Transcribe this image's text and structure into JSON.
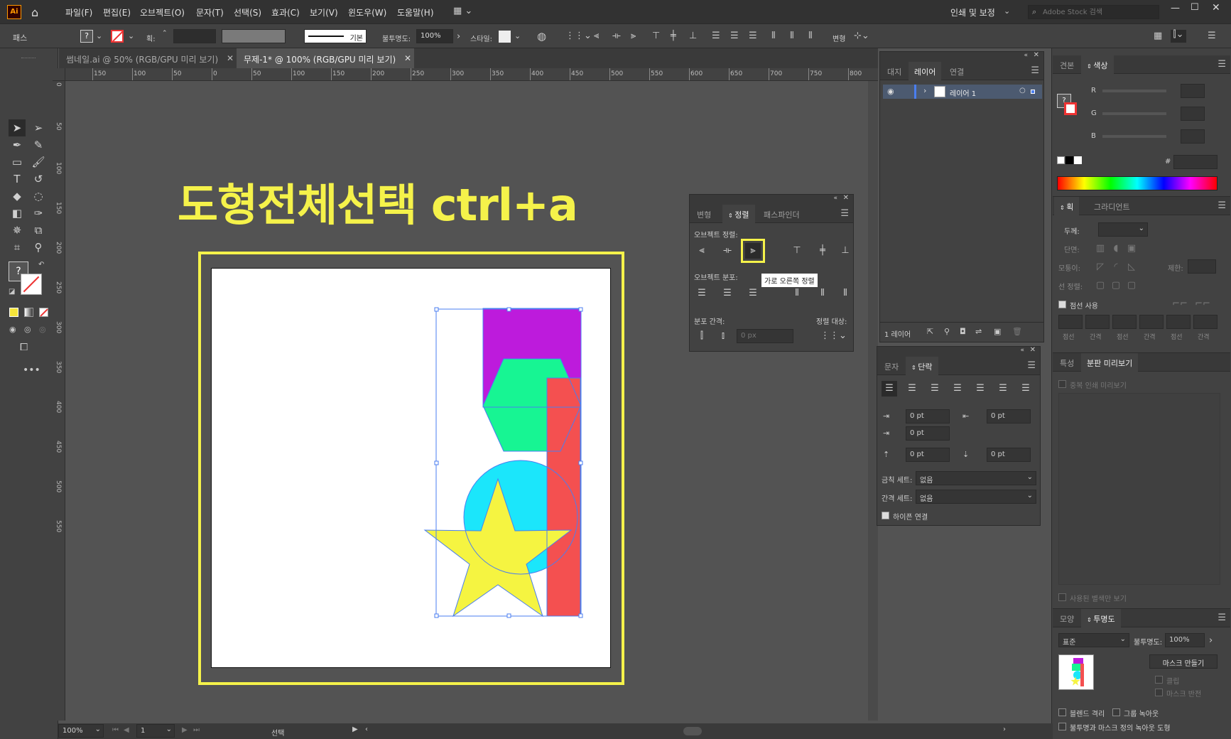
{
  "app": {
    "logo": "Ai"
  },
  "menu": [
    "파일(F)",
    "편집(E)",
    "오브젝트(O)",
    "문자(T)",
    "선택(S)",
    "효과(C)",
    "보기(V)",
    "윈도우(W)",
    "도움말(H)"
  ],
  "workspace": "인쇄 및 보정",
  "search": {
    "placeholder": "Adobe Stock 검색"
  },
  "control": {
    "object_type": "패스",
    "stroke_label": "획:",
    "stroke_style": "기본",
    "opacity_label": "불투명도:",
    "opacity": "100%",
    "style_label": "스타일:",
    "transform_label": "변형"
  },
  "doc_tabs": [
    {
      "label": "썸네일.ai @ 50% (RGB/GPU 미리 보기)"
    },
    {
      "label": "무제-1* @ 100% (RGB/GPU 미리 보기)"
    }
  ],
  "ruler_h": [
    "150",
    "100",
    "50",
    "0",
    "50",
    "100",
    "150",
    "200",
    "250",
    "300",
    "350",
    "400",
    "450",
    "500",
    "550",
    "600",
    "650",
    "700",
    "750",
    "800"
  ],
  "ruler_v": [
    "0",
    "50",
    "100",
    "150",
    "200",
    "250",
    "300",
    "350",
    "400",
    "450",
    "500",
    "550"
  ],
  "overlay": {
    "title": "도형전체선택 ctrl+a"
  },
  "align_panel": {
    "tabs": [
      "변형",
      "정렬",
      "패스파인더"
    ],
    "align_label": "오브젝트 정렬:",
    "distribute_label": "오브젝트 분포:",
    "spacing_label": "분포 간격:",
    "align_to_label": "정렬 대상:",
    "tooltip": "가로 오른쪽 정렬",
    "spacing_value": "0 px"
  },
  "layers_panel": {
    "tabs": [
      "대지",
      "레이어",
      "연결"
    ],
    "layer_name": "레이어 1",
    "footer": "1 레이어"
  },
  "char_panel": {
    "tabs": [
      "문자",
      "단락"
    ],
    "indent_left": "0 pt",
    "indent_right": "0 pt",
    "first_line": "0 pt",
    "space_before": "0 pt",
    "space_after": "0 pt",
    "kinsoku_label": "금칙 세트:",
    "kinsoku_value": "없음",
    "mojikumi_label": "간격 세트:",
    "mojikumi_value": "없음",
    "hyphen_label": "하이픈 연결"
  },
  "color_panel": {
    "tabs": [
      "견본",
      "색상"
    ],
    "r": "R",
    "g": "G",
    "b": "B",
    "hash": "#"
  },
  "stroke_panel": {
    "tabs": [
      "획",
      "그라디언트"
    ],
    "weight_label": "두께:",
    "cap_label": "단면:",
    "corner_label": "모퉁이:",
    "limit_label": "제한:",
    "align_label": "선 정렬:",
    "dashed_label": "점선 사용",
    "dash_labels": [
      "점선",
      "간격",
      "점선",
      "간격",
      "점선",
      "간격"
    ]
  },
  "attr_panel": {
    "tabs": [
      "특성",
      "분판 미리보기"
    ],
    "overprint": "중복 인쇄 미리보기",
    "spot": "사용된 별색만 보기"
  },
  "transp_panel": {
    "tabs": [
      "모양",
      "투명도"
    ],
    "mode": "표준",
    "opacity_label": "불투명도:",
    "opacity": "100%",
    "make_mask": "마스크 만들기",
    "clip": "클립",
    "invert": "마스크 반전",
    "isolate": "블렌드 격리",
    "knockout": "그룹 녹아웃",
    "opacity_mask": "불투명과 마스크 정의 녹아웃 도형"
  },
  "status": {
    "zoom": "100%",
    "artboard": "1",
    "tool": "선택"
  },
  "colors": {
    "accent": "#f5f24a",
    "purple": "#bd1bdc",
    "green": "#17f593",
    "red": "#f45050",
    "cyan": "#1be6fb",
    "star": "#f5f441",
    "selection": "#4a7ef0"
  }
}
